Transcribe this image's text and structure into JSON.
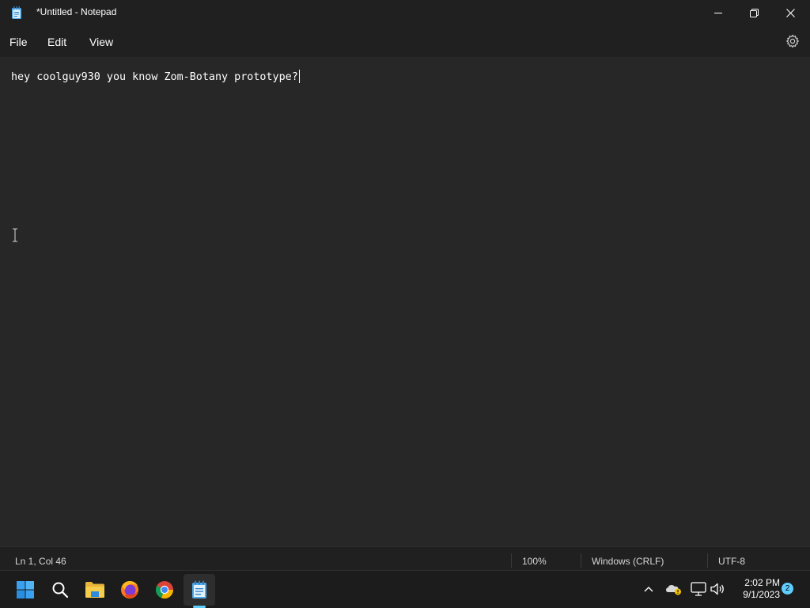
{
  "window": {
    "title": "*Untitled - Notepad"
  },
  "menu": {
    "file": "File",
    "edit": "Edit",
    "view": "View"
  },
  "editor": {
    "content": "hey coolguy930 you know Zom-Botany prototype?"
  },
  "status": {
    "position": "Ln 1, Col 46",
    "zoom": "100%",
    "line_ending": "Windows (CRLF)",
    "encoding": "UTF-8"
  },
  "taskbar": {
    "apps": [
      "start-icon",
      "search-icon",
      "file-explorer-icon",
      "firefox-icon",
      "chrome-icon",
      "notepad-icon"
    ],
    "active_app": "notepad"
  },
  "tray": {
    "time": "2:02 PM",
    "date": "9/1/2023",
    "notifications": "2"
  },
  "colors": {
    "editor_bg": "#272727",
    "chrome_bg": "#202020",
    "accent": "#60cdff"
  }
}
